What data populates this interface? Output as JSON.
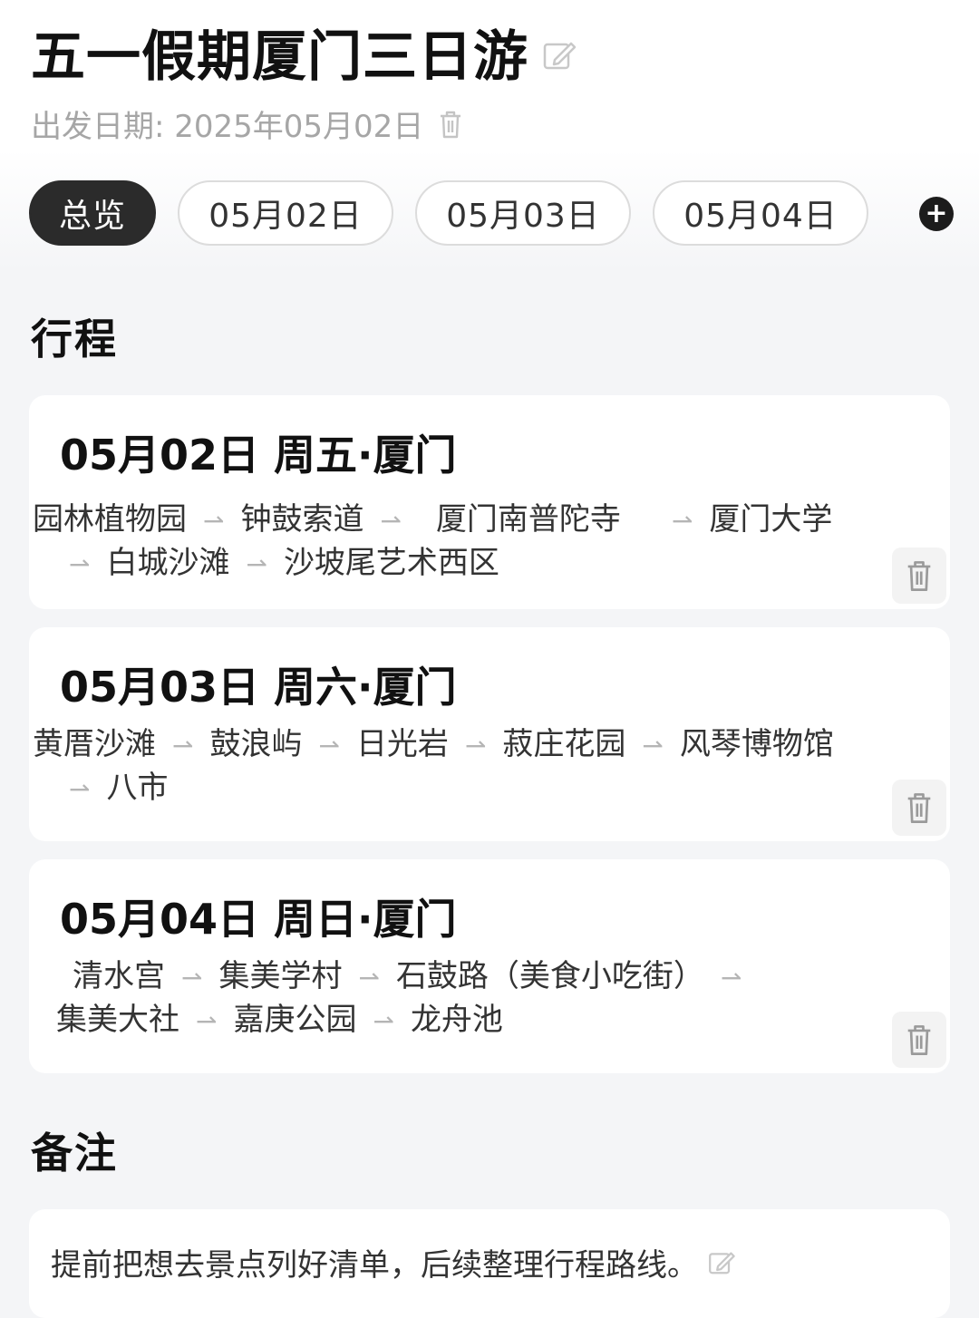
{
  "header": {
    "title": "五一假期厦门三日游",
    "departure_label": "出发日期: 2025年05月02日"
  },
  "tabs": [
    {
      "label": "总览",
      "active": true
    },
    {
      "label": "05月02日",
      "active": false
    },
    {
      "label": "05月03日",
      "active": false
    },
    {
      "label": "05月04日",
      "active": false
    }
  ],
  "add_button": "+",
  "itinerary": {
    "section_title": "行程",
    "days": [
      {
        "title": "05月02日 周五·厦门",
        "stops": [
          "园林植物园",
          "钟鼓索道",
          "厦门南普陀寺",
          "厦门大学",
          "白城沙滩",
          "沙坡尾艺术西区"
        ]
      },
      {
        "title": "05月03日 周六·厦门",
        "stops": [
          "黄厝沙滩",
          "鼓浪屿",
          "日光岩",
          "菽庄花园",
          "风琴博物馆",
          "八市"
        ]
      },
      {
        "title": "05月04日 周日·厦门",
        "stops": [
          "清水宫",
          "集美学村",
          "石鼓路（美食小吃街）",
          "集美大社",
          "嘉庚公园",
          "龙舟池"
        ]
      }
    ]
  },
  "notes": {
    "section_title": "备注",
    "text": "提前把想去景点列好清单，后续整理行程路线。"
  },
  "arrow_glyph": "⇀",
  "icons": {
    "edit": "edit-icon",
    "trash": "trash-icon",
    "add": "plus-circle-icon"
  },
  "colors": {
    "active_tab_bg": "#2b2b2b",
    "muted_text": "#a6a6a6",
    "page_bg": "#f4f5f7"
  }
}
